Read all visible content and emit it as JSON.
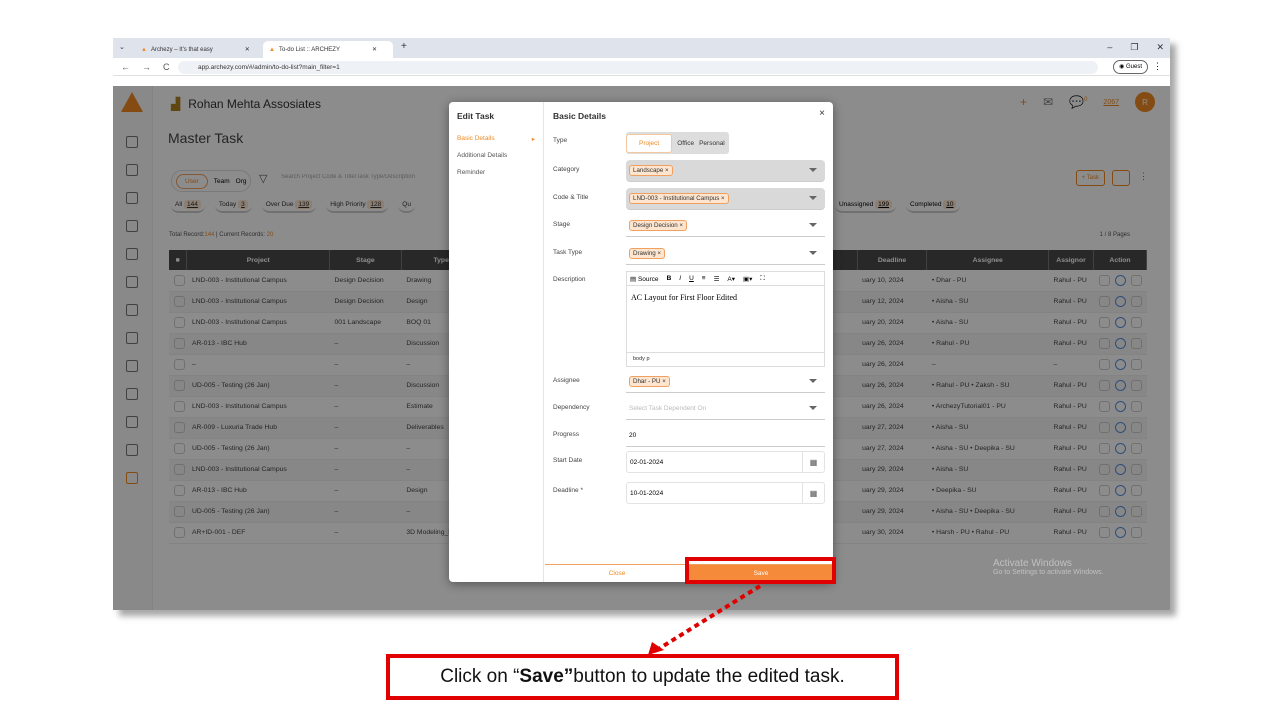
{
  "browser": {
    "tabs": [
      {
        "label": "Archezy – It's that easy"
      },
      {
        "label": "To-do List :: ARCHEZY"
      }
    ],
    "url": "app.archezy.com/#/admin/to-do-list?main_filter=1",
    "guest": "Guest"
  },
  "app": {
    "company": "Rohan Mehta Assosiates",
    "page_title": "Master Task",
    "segments": [
      "User",
      "Team",
      "Org"
    ],
    "search_placeholder": "Search Project Code & Title/Task Type/Description",
    "filters": [
      {
        "label": "All",
        "count": "144"
      },
      {
        "label": "Today",
        "count": "3"
      },
      {
        "label": "Over Due",
        "count": "139"
      },
      {
        "label": "High Priority",
        "count": "128"
      },
      {
        "label": "Qu",
        "count": ""
      }
    ],
    "filters_right": [
      {
        "label": "Unassigned",
        "count": "199"
      },
      {
        "label": "Completed",
        "count": "10"
      }
    ],
    "records_prefix": "Total Record:",
    "records_total": "144",
    "records_mid": " | Current Records: ",
    "records_current": "20",
    "pages": "1 / 8 Pages",
    "task_button": "+ Task",
    "notif_count": "0",
    "year": "2067",
    "avatar": "R",
    "columns": [
      "Project",
      "Stage",
      "Type",
      "",
      "Deadline",
      "Assignee",
      "Assignor",
      "Action"
    ],
    "rows": [
      [
        "LND-003 - Institutional Campus",
        "Design Decision",
        "Drawing",
        "uary 10, 2024",
        "• Dhar - PU",
        "Rahul - PU"
      ],
      [
        "LND-003 - Institutional Campus",
        "Design Decision",
        "Design",
        "uary 12, 2024",
        "• Aisha - SU",
        "Rahul - PU"
      ],
      [
        "LND-003 - Institutional Campus",
        "001 Landscape",
        "BOQ 01",
        "uary 20, 2024",
        "• Aisha - SU",
        "Rahul - PU"
      ],
      [
        "AR-013 - IBC Hub",
        "–",
        "Discussion",
        "uary 26, 2024",
        "• Rahul - PU",
        "Rahul - PU"
      ],
      [
        "–",
        "–",
        "–",
        "uary 26, 2024",
        "–",
        "–"
      ],
      [
        "UD-005 - Testing (26 Jan)",
        "–",
        "Discussion",
        "uary 26, 2024",
        "• Rahul - PU • Zaksh - SU",
        "Rahul - PU"
      ],
      [
        "LND-003 - Institutional Campus",
        "–",
        "Estimate",
        "uary 26, 2024",
        "• ArchezyTutorial01 - PU",
        "Rahul - PU"
      ],
      [
        "AR-009 - Luxuria Trade Hub",
        "–",
        "Deliverables",
        "uary 27, 2024",
        "• Aisha - SU",
        "Rahul - PU"
      ],
      [
        "UD-005 - Testing (26 Jan)",
        "–",
        "–",
        "uary 27, 2024",
        "• Aisha - SU • Deepika - SU",
        "Rahul - PU"
      ],
      [
        "LND-003 - Institutional Campus",
        "–",
        "–",
        "uary 29, 2024",
        "• Aisha - SU",
        "Rahul - PU"
      ],
      [
        "AR-013 - IBC Hub",
        "–",
        "Design",
        "uary 29, 2024",
        "• Deepika - SU",
        "Rahul - PU"
      ],
      [
        "UD-005 - Testing (26 Jan)",
        "–",
        "–",
        "uary 29, 2024",
        "• Aisha - SU • Deepika - SU",
        "Rahul - PU"
      ],
      [
        "AR+ID-001 - DEF",
        "–",
        "3D Modeling_Bl",
        "uary 30, 2024",
        "• Harsh - PU • Rahul - PU",
        "Rahul - PU"
      ]
    ]
  },
  "modal": {
    "side_title": "Edit Task",
    "side_items": [
      "Basic Details",
      "Additional Details",
      "Reminder"
    ],
    "title": "Basic Details",
    "close_x": "×",
    "labels": {
      "type": "Type",
      "category": "Category",
      "code": "Code & Title",
      "stage": "Stage",
      "task_type": "Task Type",
      "description": "Description",
      "assignee": "Assignee",
      "dependency": "Dependency",
      "progress": "Progress",
      "start_date": "Start Date",
      "deadline": "Deadline *"
    },
    "type_options": [
      "Project",
      "Office",
      "Personal"
    ],
    "category": "Landscape ×",
    "code": "LND-003 - Institutional Campus ×",
    "stage": "Design Decision ×",
    "task_type": "Drawing ×",
    "editor_source": "Source",
    "description": "AC Layout for First Floor Edited",
    "editor_footer": "body  p",
    "assignee": "Dhar - PU ×",
    "dependency_placeholder": "Select Task Dependent On",
    "progress": "20",
    "start_date": "02-01-2024",
    "deadline": "10-01-2024",
    "close_btn": "Close",
    "save_btn": "Save"
  },
  "watermark": {
    "title": "Activate Windows",
    "sub": "Go to Settings to activate Windows."
  },
  "callout": {
    "pre": "Click on “",
    "bold": "Save”",
    "post": " button to update the edited task."
  },
  "colors": {
    "accent": "#f08a24",
    "highlight": "#e00000"
  }
}
